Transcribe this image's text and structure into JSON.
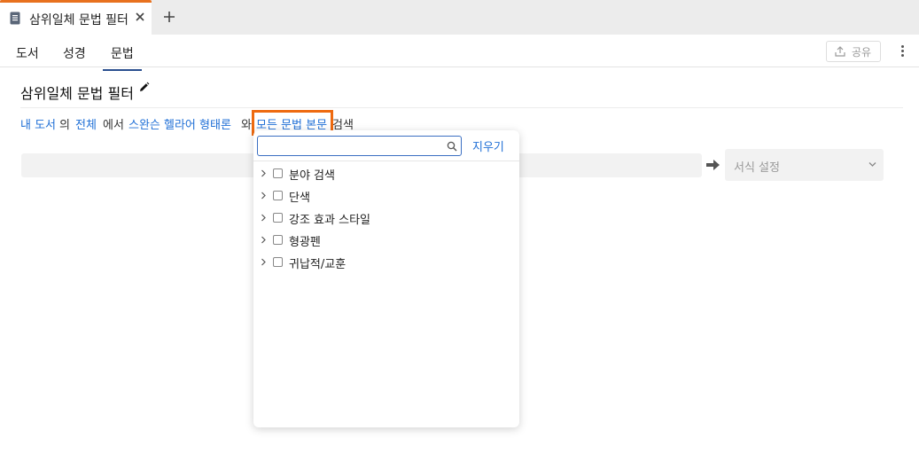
{
  "tab": {
    "title": "삼위일체 문법 필터"
  },
  "nav": {
    "tabs": [
      {
        "label": "도서"
      },
      {
        "label": "성경"
      },
      {
        "label": "문법"
      }
    ],
    "share_label": "공유"
  },
  "page": {
    "title": "삼위일체 문법 필터"
  },
  "query": {
    "my_library": "내 도서",
    "of": "의",
    "all": "전체",
    "in": "에서",
    "morph": "스완슨 헬라어 형태론",
    "and": "와",
    "all_text": "모든 문법 본문",
    "search": "검색"
  },
  "format": {
    "label": "서식 설정"
  },
  "dropdown": {
    "search_placeholder": "",
    "clear_label": "지우기",
    "items": [
      {
        "label": "분야 검색"
      },
      {
        "label": "단색"
      },
      {
        "label": "강조 효과 스타일"
      },
      {
        "label": "형광펜"
      },
      {
        "label": "귀납적/교훈"
      }
    ]
  },
  "colors": {
    "accent": "#e8711f",
    "link": "#1f6fd6",
    "highlight": "#ee6a10"
  }
}
